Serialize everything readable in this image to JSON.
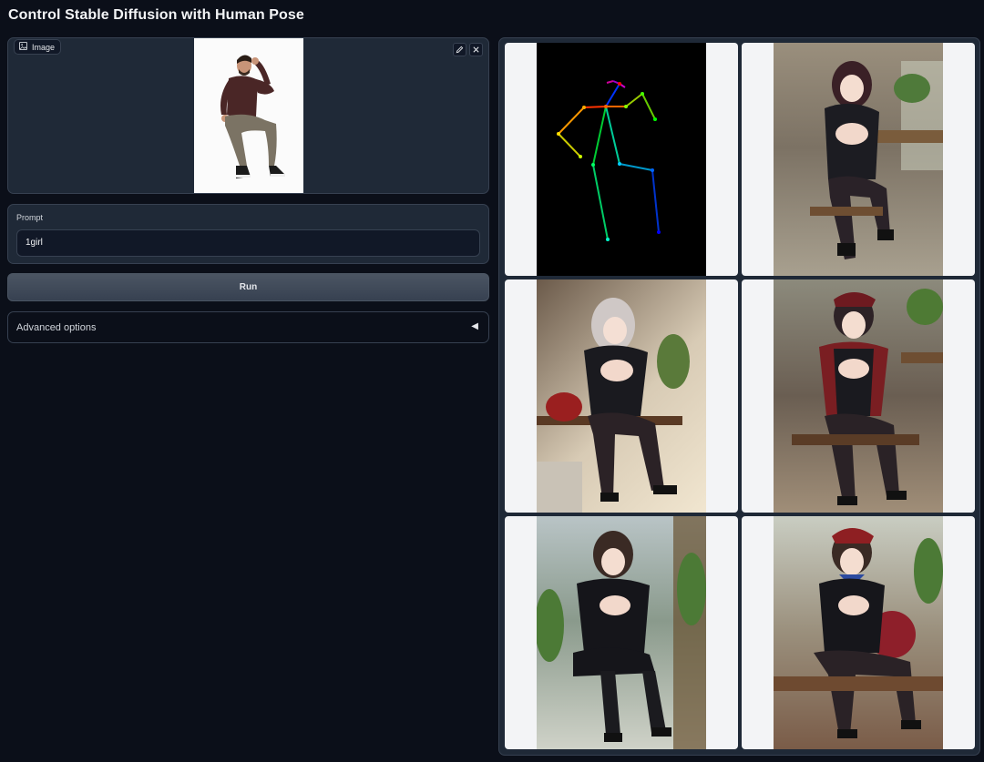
{
  "title": "Control Stable Diffusion with Human Pose",
  "image_input": {
    "label": "Image",
    "icon": "image-icon",
    "tools": [
      "edit-icon",
      "close-icon"
    ]
  },
  "prompt": {
    "label": "Prompt",
    "value": "1girl"
  },
  "run_button": {
    "label": "Run"
  },
  "advanced": {
    "label": "Advanced options",
    "arrow": "◀"
  },
  "gallery": {
    "items": [
      {
        "kind": "pose-skeleton"
      },
      {
        "kind": "generated-image"
      },
      {
        "kind": "generated-image"
      },
      {
        "kind": "generated-image"
      },
      {
        "kind": "generated-image"
      },
      {
        "kind": "generated-image"
      }
    ]
  },
  "colors": {
    "background": "#0b0f19",
    "panel": "#1f2937",
    "border": "#374151"
  }
}
